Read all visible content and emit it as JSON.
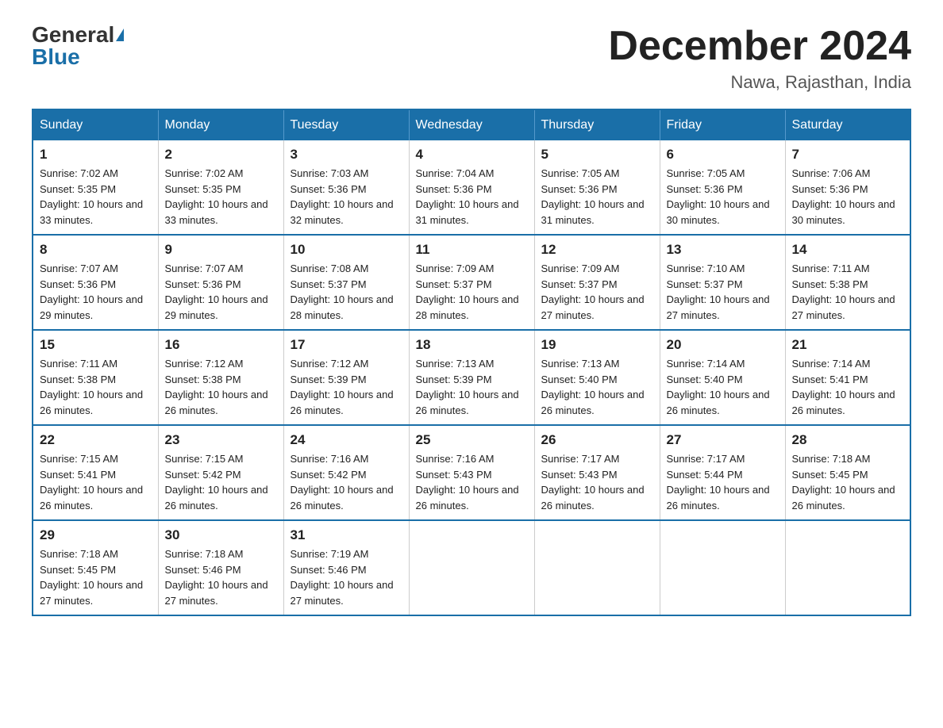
{
  "header": {
    "logo_general": "General",
    "logo_blue": "Blue",
    "month_title": "December 2024",
    "location": "Nawa, Rajasthan, India"
  },
  "weekdays": [
    "Sunday",
    "Monday",
    "Tuesday",
    "Wednesday",
    "Thursday",
    "Friday",
    "Saturday"
  ],
  "weeks": [
    [
      {
        "day": "1",
        "sunrise": "7:02 AM",
        "sunset": "5:35 PM",
        "daylight": "10 hours and 33 minutes."
      },
      {
        "day": "2",
        "sunrise": "7:02 AM",
        "sunset": "5:35 PM",
        "daylight": "10 hours and 33 minutes."
      },
      {
        "day": "3",
        "sunrise": "7:03 AM",
        "sunset": "5:36 PM",
        "daylight": "10 hours and 32 minutes."
      },
      {
        "day": "4",
        "sunrise": "7:04 AM",
        "sunset": "5:36 PM",
        "daylight": "10 hours and 31 minutes."
      },
      {
        "day": "5",
        "sunrise": "7:05 AM",
        "sunset": "5:36 PM",
        "daylight": "10 hours and 31 minutes."
      },
      {
        "day": "6",
        "sunrise": "7:05 AM",
        "sunset": "5:36 PM",
        "daylight": "10 hours and 30 minutes."
      },
      {
        "day": "7",
        "sunrise": "7:06 AM",
        "sunset": "5:36 PM",
        "daylight": "10 hours and 30 minutes."
      }
    ],
    [
      {
        "day": "8",
        "sunrise": "7:07 AM",
        "sunset": "5:36 PM",
        "daylight": "10 hours and 29 minutes."
      },
      {
        "day": "9",
        "sunrise": "7:07 AM",
        "sunset": "5:36 PM",
        "daylight": "10 hours and 29 minutes."
      },
      {
        "day": "10",
        "sunrise": "7:08 AM",
        "sunset": "5:37 PM",
        "daylight": "10 hours and 28 minutes."
      },
      {
        "day": "11",
        "sunrise": "7:09 AM",
        "sunset": "5:37 PM",
        "daylight": "10 hours and 28 minutes."
      },
      {
        "day": "12",
        "sunrise": "7:09 AM",
        "sunset": "5:37 PM",
        "daylight": "10 hours and 27 minutes."
      },
      {
        "day": "13",
        "sunrise": "7:10 AM",
        "sunset": "5:37 PM",
        "daylight": "10 hours and 27 minutes."
      },
      {
        "day": "14",
        "sunrise": "7:11 AM",
        "sunset": "5:38 PM",
        "daylight": "10 hours and 27 minutes."
      }
    ],
    [
      {
        "day": "15",
        "sunrise": "7:11 AM",
        "sunset": "5:38 PM",
        "daylight": "10 hours and 26 minutes."
      },
      {
        "day": "16",
        "sunrise": "7:12 AM",
        "sunset": "5:38 PM",
        "daylight": "10 hours and 26 minutes."
      },
      {
        "day": "17",
        "sunrise": "7:12 AM",
        "sunset": "5:39 PM",
        "daylight": "10 hours and 26 minutes."
      },
      {
        "day": "18",
        "sunrise": "7:13 AM",
        "sunset": "5:39 PM",
        "daylight": "10 hours and 26 minutes."
      },
      {
        "day": "19",
        "sunrise": "7:13 AM",
        "sunset": "5:40 PM",
        "daylight": "10 hours and 26 minutes."
      },
      {
        "day": "20",
        "sunrise": "7:14 AM",
        "sunset": "5:40 PM",
        "daylight": "10 hours and 26 minutes."
      },
      {
        "day": "21",
        "sunrise": "7:14 AM",
        "sunset": "5:41 PM",
        "daylight": "10 hours and 26 minutes."
      }
    ],
    [
      {
        "day": "22",
        "sunrise": "7:15 AM",
        "sunset": "5:41 PM",
        "daylight": "10 hours and 26 minutes."
      },
      {
        "day": "23",
        "sunrise": "7:15 AM",
        "sunset": "5:42 PM",
        "daylight": "10 hours and 26 minutes."
      },
      {
        "day": "24",
        "sunrise": "7:16 AM",
        "sunset": "5:42 PM",
        "daylight": "10 hours and 26 minutes."
      },
      {
        "day": "25",
        "sunrise": "7:16 AM",
        "sunset": "5:43 PM",
        "daylight": "10 hours and 26 minutes."
      },
      {
        "day": "26",
        "sunrise": "7:17 AM",
        "sunset": "5:43 PM",
        "daylight": "10 hours and 26 minutes."
      },
      {
        "day": "27",
        "sunrise": "7:17 AM",
        "sunset": "5:44 PM",
        "daylight": "10 hours and 26 minutes."
      },
      {
        "day": "28",
        "sunrise": "7:18 AM",
        "sunset": "5:45 PM",
        "daylight": "10 hours and 26 minutes."
      }
    ],
    [
      {
        "day": "29",
        "sunrise": "7:18 AM",
        "sunset": "5:45 PM",
        "daylight": "10 hours and 27 minutes."
      },
      {
        "day": "30",
        "sunrise": "7:18 AM",
        "sunset": "5:46 PM",
        "daylight": "10 hours and 27 minutes."
      },
      {
        "day": "31",
        "sunrise": "7:19 AM",
        "sunset": "5:46 PM",
        "daylight": "10 hours and 27 minutes."
      },
      null,
      null,
      null,
      null
    ]
  ]
}
